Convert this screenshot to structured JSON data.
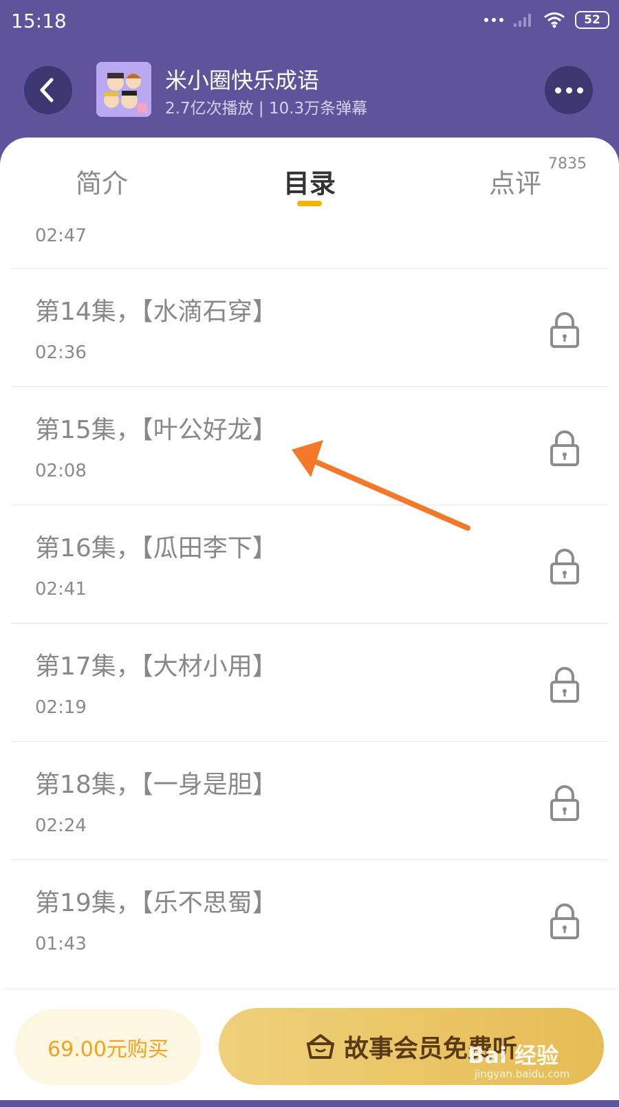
{
  "status_bar": {
    "time": "15:18",
    "battery": "52"
  },
  "header": {
    "title": "米小圈快乐成语",
    "subtitle": "2.7亿次播放 | 10.3万条弹幕"
  },
  "tabs": [
    {
      "label": "简介"
    },
    {
      "label": "目录"
    },
    {
      "label": "点评",
      "badge": "7835"
    }
  ],
  "episodes": [
    {
      "title": "",
      "duration": "02:47"
    },
    {
      "title": "第14集，【水滴石穿】",
      "duration": "02:36"
    },
    {
      "title": "第15集，【叶公好龙】",
      "duration": "02:08"
    },
    {
      "title": "第16集，【瓜田李下】",
      "duration": "02:41"
    },
    {
      "title": "第17集，【大材小用】",
      "duration": "02:19"
    },
    {
      "title": "第18集，【一身是胆】",
      "duration": "02:24"
    },
    {
      "title": "第19集，【乐不思蜀】",
      "duration": "01:43"
    }
  ],
  "bottom": {
    "buy_label": "69.00元购买",
    "member_label": "故事会员免费听"
  },
  "watermark": {
    "brand": "Bai 经验",
    "url": "jingyan.baidu.com"
  },
  "colors": {
    "header_bg": "#5f549b",
    "accent": "#f5b400",
    "arrow": "#f4782a"
  }
}
